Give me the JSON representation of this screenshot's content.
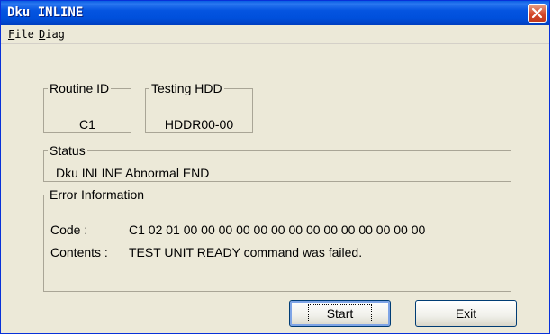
{
  "window": {
    "title": "Dku INLINE"
  },
  "menu": [
    {
      "accel": "F",
      "rest": "ile"
    },
    {
      "accel": "D",
      "rest": "iag"
    }
  ],
  "routine": {
    "label": "Routine ID",
    "value": "C1"
  },
  "testing": {
    "label": "Testing HDD",
    "value": "HDDR00-00"
  },
  "status": {
    "label": "Status",
    "value": "Dku INLINE Abnormal END"
  },
  "error": {
    "label": "Error Information",
    "code_label": "Code :",
    "code_value": "C1 02 01 00 00 00 00 00 00 00 00 00 00 00 00 00 00",
    "contents_label": "Contents :",
    "contents_value": "TEST UNIT READY command was failed."
  },
  "buttons": {
    "start": "Start",
    "exit": "Exit"
  },
  "icons": {
    "close": "close-icon"
  }
}
